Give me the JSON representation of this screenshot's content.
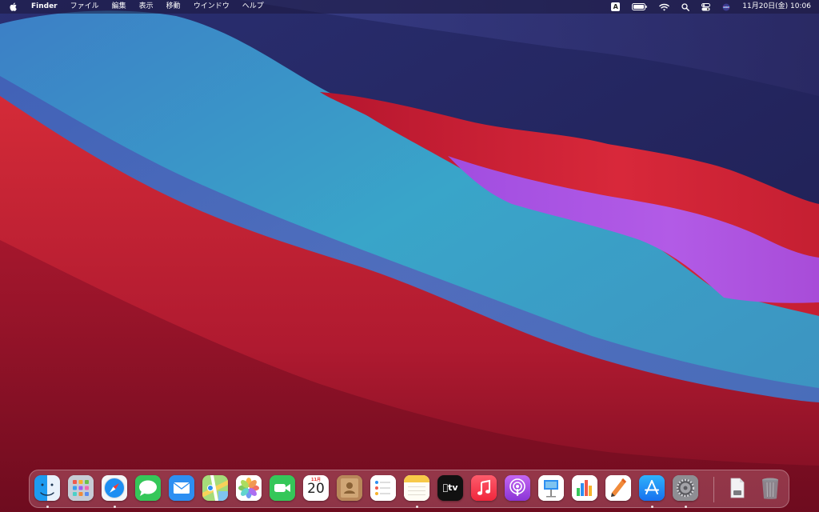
{
  "menubar": {
    "app_name": "Finder",
    "menus": [
      "ファイル",
      "編集",
      "表示",
      "移動",
      "ウインドウ",
      "ヘルプ"
    ],
    "input_source": "A",
    "datetime": "11月20日(金)  10:06"
  },
  "dock": {
    "apps": [
      {
        "name": "Finder",
        "icon": "finder-icon",
        "running": true
      },
      {
        "name": "Launchpad",
        "icon": "launchpad-icon",
        "running": false
      },
      {
        "name": "Safari",
        "icon": "safari-icon",
        "running": true
      },
      {
        "name": "Messages",
        "icon": "messages-icon",
        "running": false
      },
      {
        "name": "Mail",
        "icon": "mail-icon",
        "running": false
      },
      {
        "name": "Maps",
        "icon": "maps-icon",
        "running": false
      },
      {
        "name": "Photos",
        "icon": "photos-icon",
        "running": false
      },
      {
        "name": "FaceTime",
        "icon": "facetime-icon",
        "running": false
      },
      {
        "name": "Calendar",
        "icon": "calendar-icon",
        "running": false,
        "month": "11月",
        "day": "20"
      },
      {
        "name": "Contacts",
        "icon": "contacts-icon",
        "running": false
      },
      {
        "name": "Reminders",
        "icon": "reminders-icon",
        "running": false
      },
      {
        "name": "Notes",
        "icon": "notes-icon",
        "running": true
      },
      {
        "name": "TV",
        "icon": "tv-icon",
        "running": false,
        "label": "tv"
      },
      {
        "name": "Music",
        "icon": "music-icon",
        "running": false
      },
      {
        "name": "Podcasts",
        "icon": "podcasts-icon",
        "running": false
      },
      {
        "name": "Keynote",
        "icon": "keynote-icon",
        "running": false
      },
      {
        "name": "Numbers",
        "icon": "numbers-icon",
        "running": false
      },
      {
        "name": "Pages",
        "icon": "pages-icon",
        "running": false
      },
      {
        "name": "App Store",
        "icon": "app-store-icon",
        "running": true
      },
      {
        "name": "System Preferences",
        "icon": "system-preferences-icon",
        "running": true
      }
    ],
    "extras": [
      {
        "name": "Downloads",
        "icon": "downloads-stack-icon"
      },
      {
        "name": "Trash",
        "icon": "trash-icon"
      }
    ]
  },
  "colors": {
    "wallpaper_navy": "#2b2a63",
    "wallpaper_cyan": "#3aa4c8",
    "wallpaper_red": "#d8283a",
    "wallpaper_purple": "#b25be6",
    "wallpaper_maroon": "#7a0d22"
  }
}
